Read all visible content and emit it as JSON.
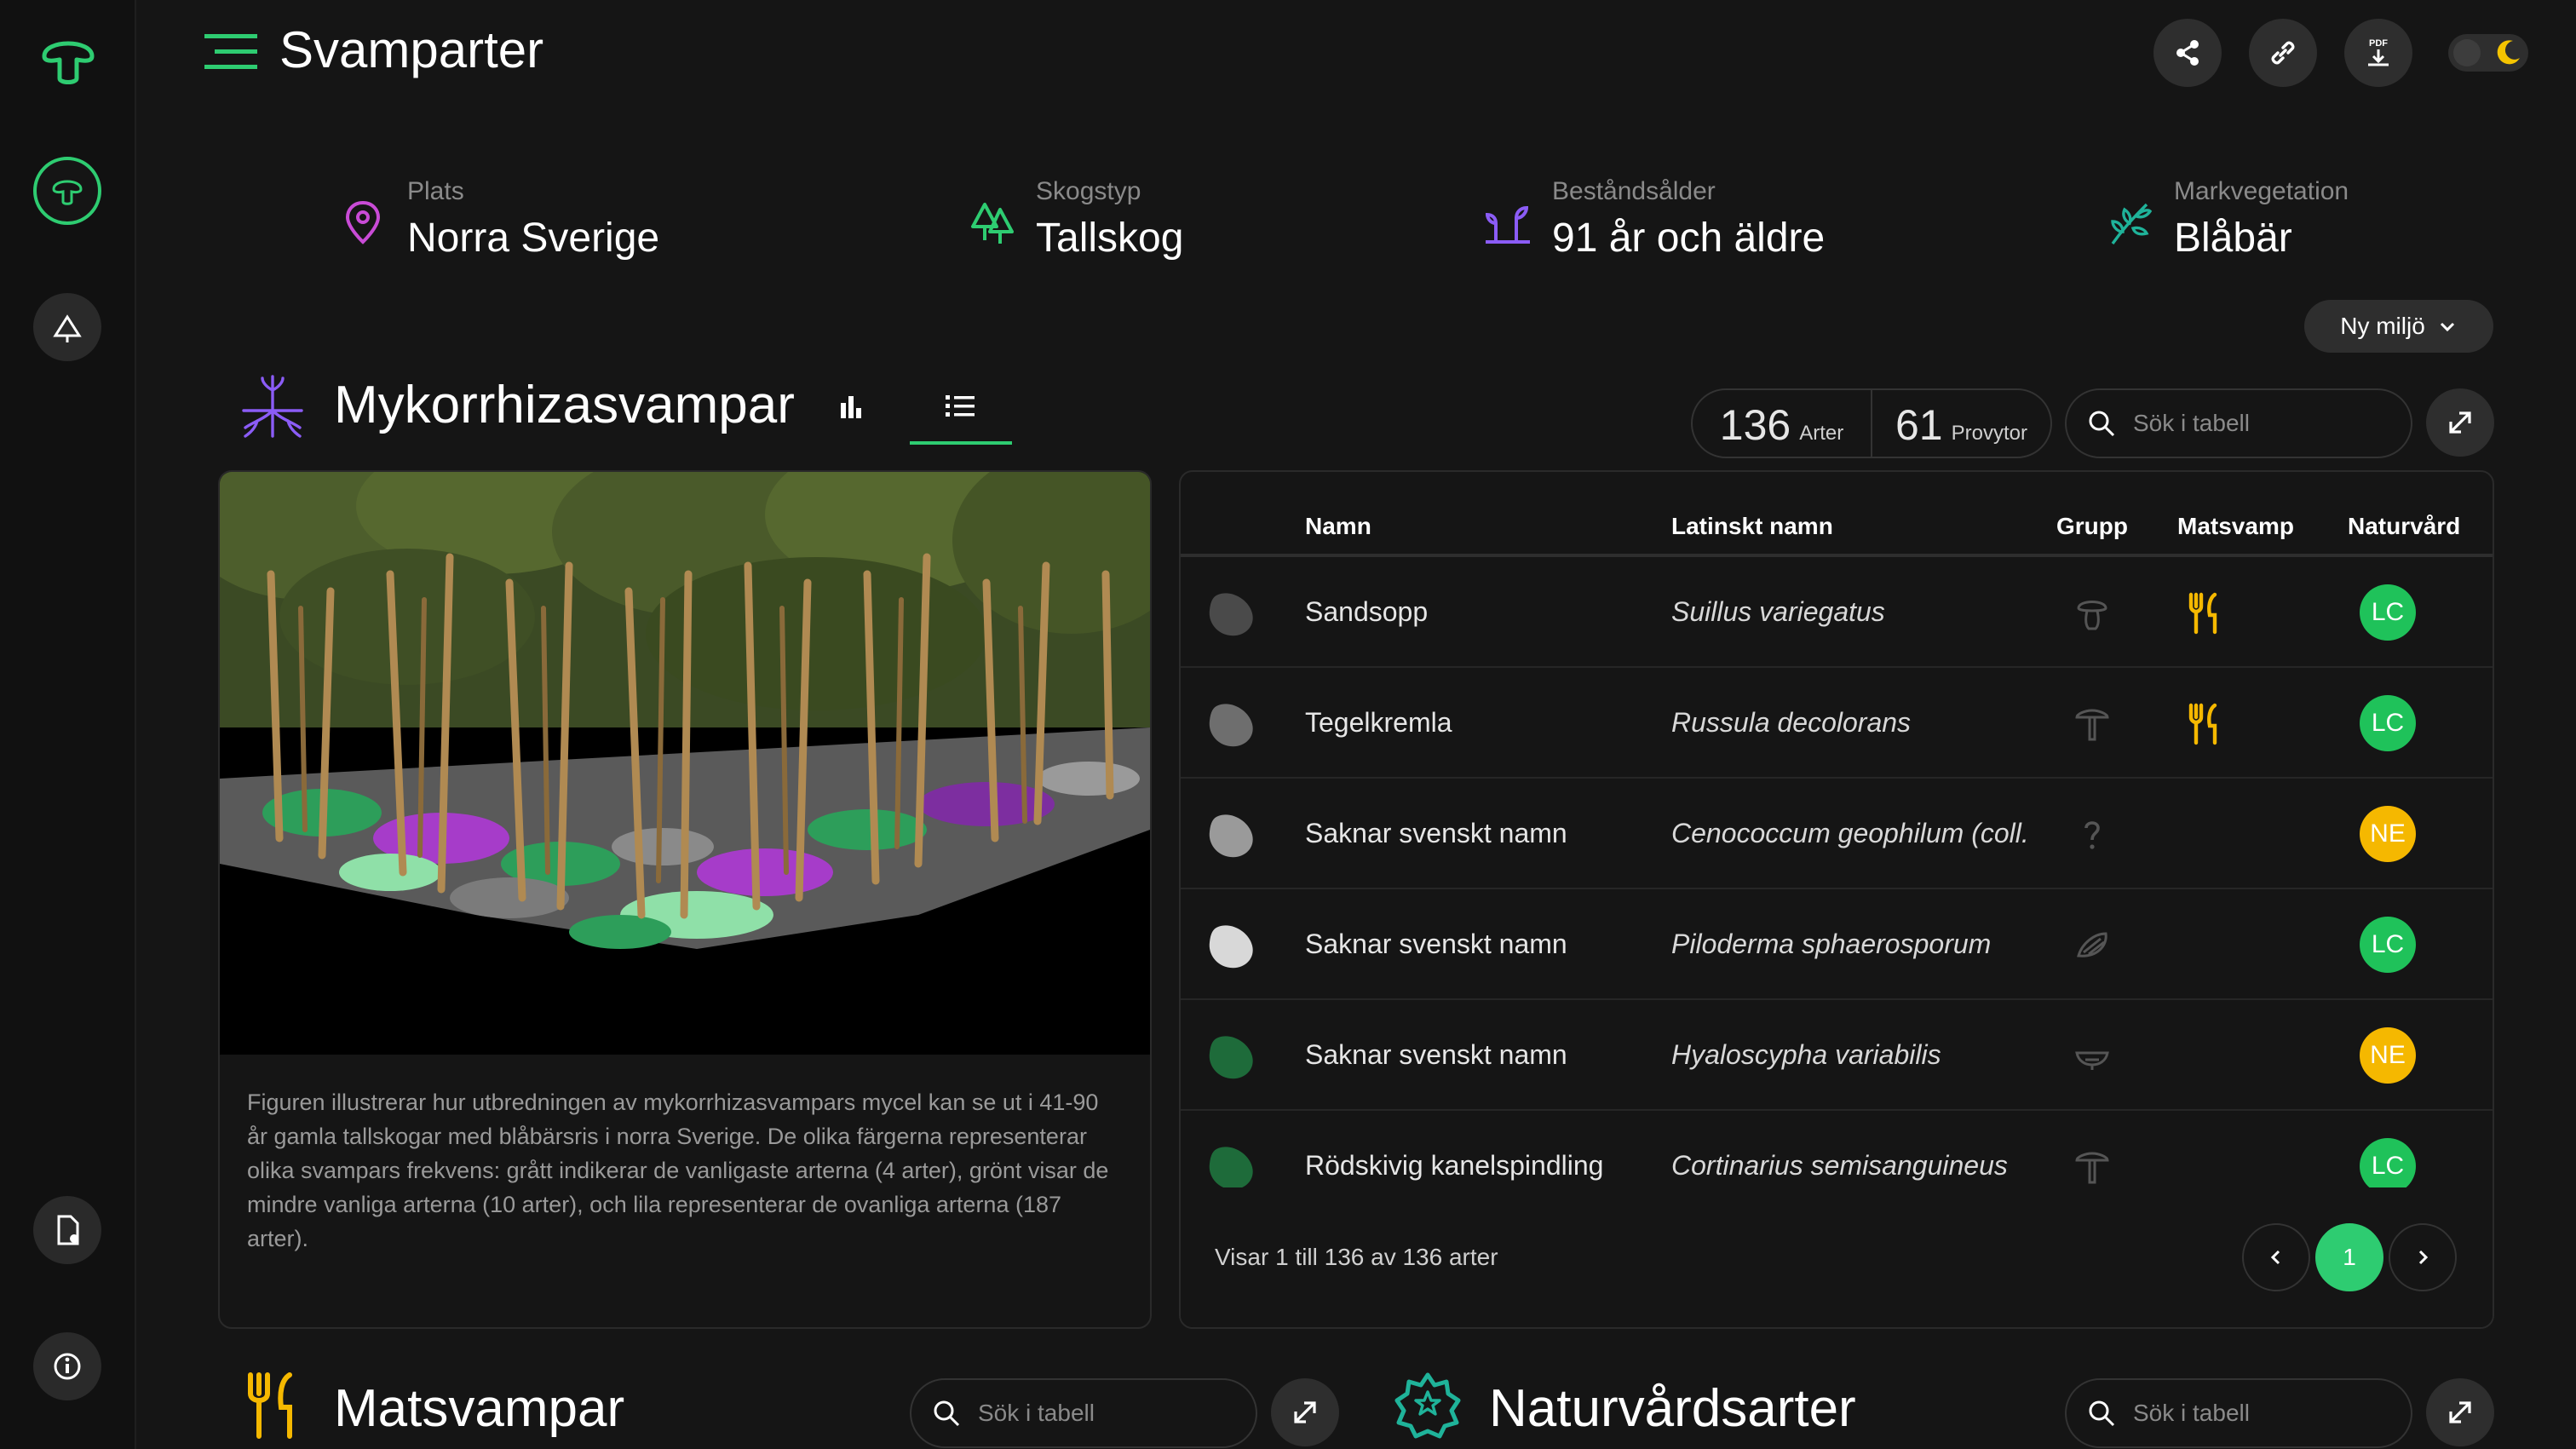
{
  "app": {
    "title": "Svamparter"
  },
  "environment": [
    {
      "label": "Plats",
      "value": "Norra Sverige",
      "icon": "map-pin-icon",
      "color": "#c94bd6"
    },
    {
      "label": "Skogstyp",
      "value": "Tallskog",
      "icon": "tree-icon",
      "color": "#2ecc71"
    },
    {
      "label": "Beståndsålder",
      "value": "91 år och äldre",
      "icon": "seedling-age-icon",
      "color": "#8b5cf6"
    },
    {
      "label": "Markvegetation",
      "value": "Blåbär",
      "icon": "leaf-plant-icon",
      "color": "#1fb39a"
    }
  ],
  "new_env_button": "Ny miljö",
  "mycorrhiza": {
    "title": "Mykorrhizasvampar",
    "stats": {
      "species_count": "136",
      "species_label": "Arter",
      "plots_count": "61",
      "plots_label": "Provytor"
    },
    "search_placeholder": "Sök i tabell",
    "caption": "Figuren illustrerar hur utbredningen av mykorrhizasvampars mycel kan se ut i 41-90 år gamla tallskogar med blåbärsris i norra Sverige. De olika färgerna representerar olika svampars frekvens: grått indikerar de vanligaste arterna (4 arter), grönt visar de mindre vanliga arterna (10 arter), och lila representerar de ovanliga arterna (187 arter).",
    "table": {
      "headers": {
        "name": "Namn",
        "latin": "Latinskt namn",
        "group": "Grupp",
        "edible": "Matsvamp",
        "conservation": "Naturvård"
      },
      "rows": [
        {
          "name": "Sandsopp",
          "latin": "Suillus variegatus",
          "blob_color": "#4a4a4a",
          "group_icon": "bolete-mushroom-icon",
          "edible": true,
          "status": "LC"
        },
        {
          "name": "Tegelkremla",
          "latin": "Russula decolorans",
          "blob_color": "#6e6e6e",
          "group_icon": "gilled-mushroom-icon",
          "edible": true,
          "status": "LC"
        },
        {
          "name": "Saknar svenskt namn",
          "latin": "Cenococcum geophilum (coll.",
          "blob_color": "#9a9a9a",
          "group_icon": "question-icon",
          "edible": false,
          "status": "NE"
        },
        {
          "name": "Saknar svenskt namn",
          "latin": "Piloderma sphaerosporum",
          "blob_color": "#d8d8d8",
          "group_icon": "crust-fungus-icon",
          "edible": false,
          "status": "LC"
        },
        {
          "name": "Saknar svenskt namn",
          "latin": "Hyaloscypha variabilis",
          "blob_color": "#1e6b3a",
          "group_icon": "cup-fungus-icon",
          "edible": false,
          "status": "NE"
        },
        {
          "name": "Rödskivig kanelspindling",
          "latin": "Cortinarius semisanguineus",
          "blob_color": "#1e6b3a",
          "group_icon": "gilled-mushroom-icon",
          "edible": false,
          "status": "LC"
        }
      ],
      "footer_text": "Visar 1 till 136 av 136 arter",
      "current_page": "1"
    }
  },
  "edible_section": {
    "title": "Matsvampar",
    "search_placeholder": "Sök i tabell"
  },
  "conservation_section": {
    "title": "Naturvårdsarter",
    "search_placeholder": "Sök i tabell"
  },
  "colors": {
    "accent": "#2ecc71",
    "edible": "#f5b800",
    "lc": "#1fc25a",
    "ne": "#f5b800"
  }
}
